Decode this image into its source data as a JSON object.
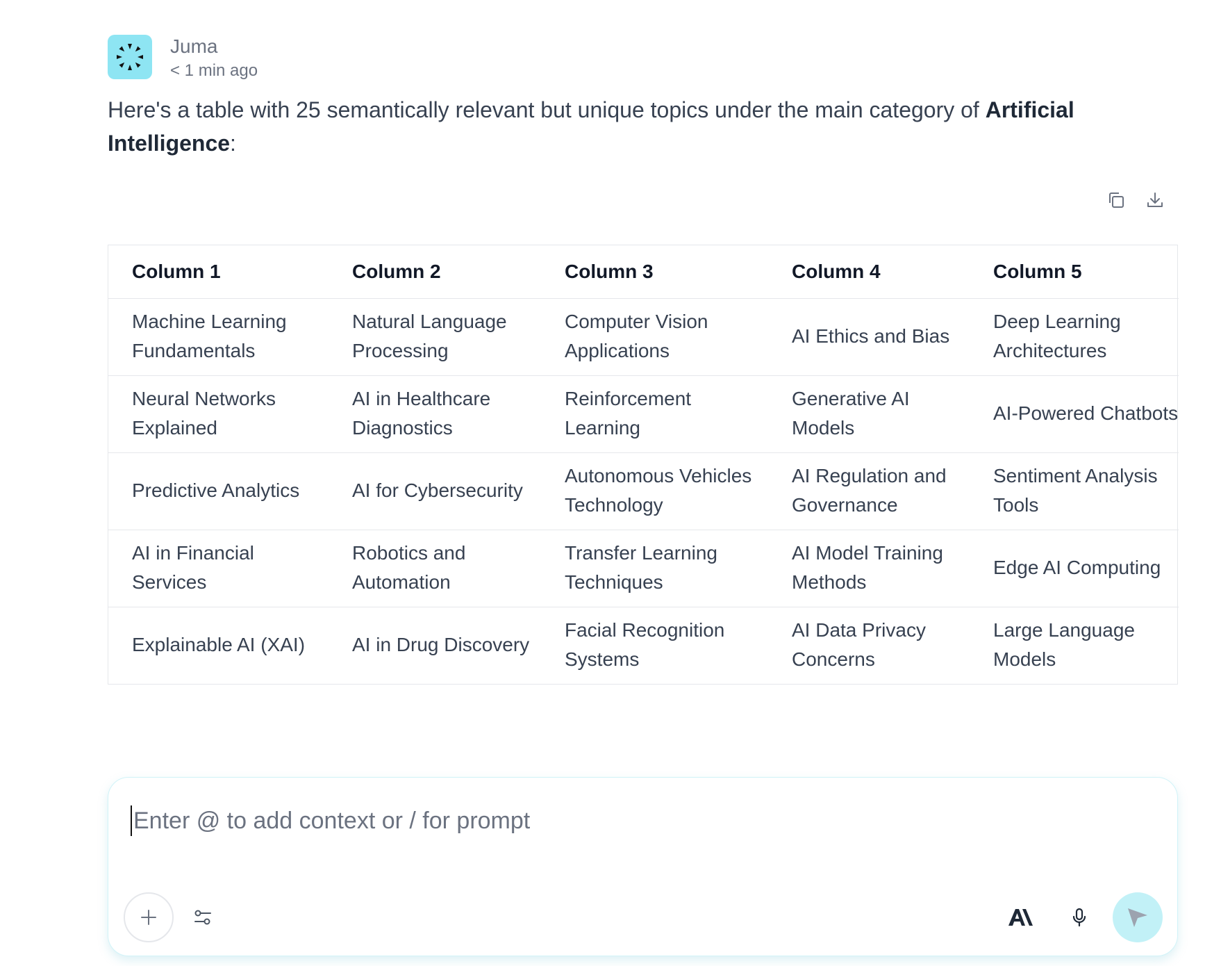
{
  "message": {
    "sender": "Juma",
    "timestamp": "< 1 min ago",
    "text_before": "Here's a table with 25 semantically relevant but unique topics under the main category of ",
    "text_bold": "Artificial Intelligence",
    "text_after": ":"
  },
  "table": {
    "headers": [
      "Column 1",
      "Column 2",
      "Column 3",
      "Column 4",
      "Column 5"
    ],
    "rows": [
      [
        "Machine Learning Fundamentals",
        "Natural Language Processing",
        "Computer Vision Applications",
        "AI Ethics and Bias",
        "Deep Learning Architectures"
      ],
      [
        "Neural Networks Explained",
        "AI in Healthcare Diagnostics",
        "Reinforcement Learning",
        "Generative AI Models",
        "AI-Powered Chatbots"
      ],
      [
        "Predictive Analytics",
        "AI for Cybersecurity",
        "Autonomous Vehicles Technology",
        "AI Regulation and Governance",
        "Sentiment Analysis Tools"
      ],
      [
        "AI in Financial Services",
        "Robotics and Automation",
        "Transfer Learning Techniques",
        "AI Model Training Methods",
        "Edge AI Computing"
      ],
      [
        "Explainable AI (XAI)",
        "AI in Drug Discovery",
        "Facial Recognition Systems",
        "AI Data Privacy Concerns",
        "Large Language Models"
      ]
    ]
  },
  "composer": {
    "placeholder": "Enter @ to add context or / for prompt"
  },
  "icons": {
    "avatar": "starburst-logo-icon",
    "copy": "copy-icon",
    "download": "download-icon",
    "add": "plus-icon",
    "settings": "sliders-icon",
    "model": "anthropic-logo-icon",
    "mic": "microphone-icon",
    "send": "send-icon"
  },
  "colors": {
    "avatar_bg": "#8ee5f3",
    "send_bg": "#c2f1f7",
    "text": "#374151",
    "muted": "#6b7280"
  }
}
